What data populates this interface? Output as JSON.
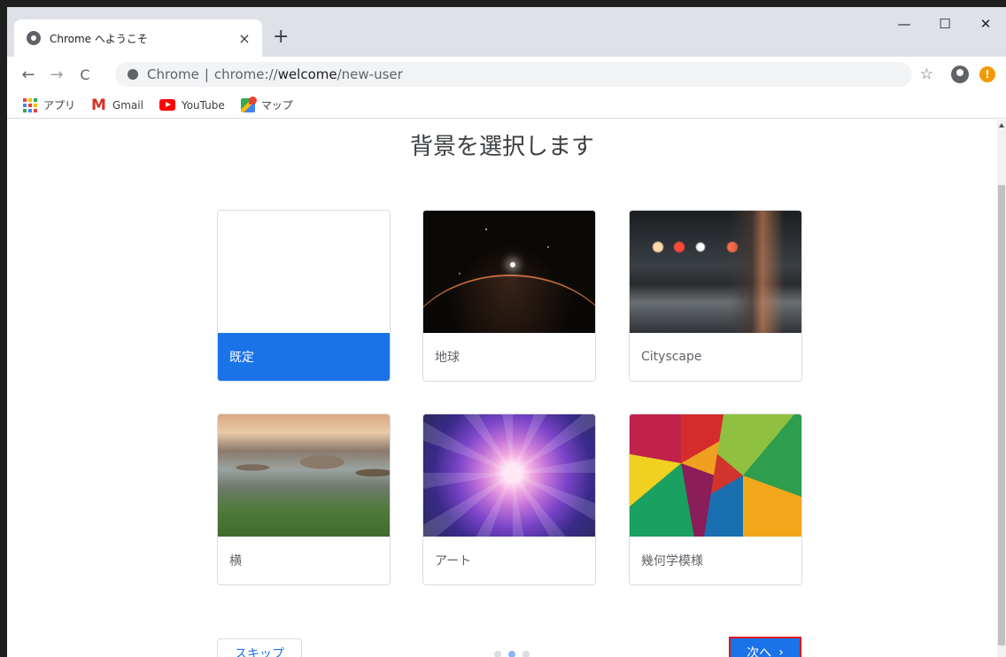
{
  "browser": {
    "tab_title": "Chrome へようこそ",
    "tab_close": "×",
    "new_tab": "+",
    "window_controls": {
      "minimize": "—",
      "maximize": "☐",
      "close": "✕"
    },
    "nav": {
      "back": "←",
      "forward": "→",
      "reload": "C"
    },
    "omnibox": {
      "site_name": "Chrome",
      "separator": "|",
      "url_scheme": "chrome://",
      "url_host": "welcome",
      "url_path": "/new-user"
    },
    "star": "☆",
    "update_badge": "!",
    "bookmarks": [
      {
        "label": "アプリ",
        "icon": "apps-grid-icon"
      },
      {
        "label": "Gmail",
        "icon": "gmail-icon"
      },
      {
        "label": "YouTube",
        "icon": "youtube-icon"
      },
      {
        "label": "マップ",
        "icon": "maps-icon"
      }
    ],
    "gmail_glyph": "M"
  },
  "page": {
    "title": "背景を選択します",
    "cards": [
      {
        "label": "既定",
        "selected": true,
        "image": "none"
      },
      {
        "label": "地球",
        "selected": false,
        "image": "earth"
      },
      {
        "label": "Cityscape",
        "selected": false,
        "image": "cityscape"
      },
      {
        "label": "横",
        "selected": false,
        "image": "landscape"
      },
      {
        "label": "アート",
        "selected": false,
        "image": "art"
      },
      {
        "label": "幾何学模様",
        "selected": false,
        "image": "geometric"
      }
    ],
    "skip_label": "スキップ",
    "next_label": "次へ",
    "next_chevron": "›",
    "progress": {
      "total": 3,
      "current": 2
    }
  },
  "colors": {
    "accent": "#1a73e8",
    "highlight_border": "#e0141c"
  }
}
